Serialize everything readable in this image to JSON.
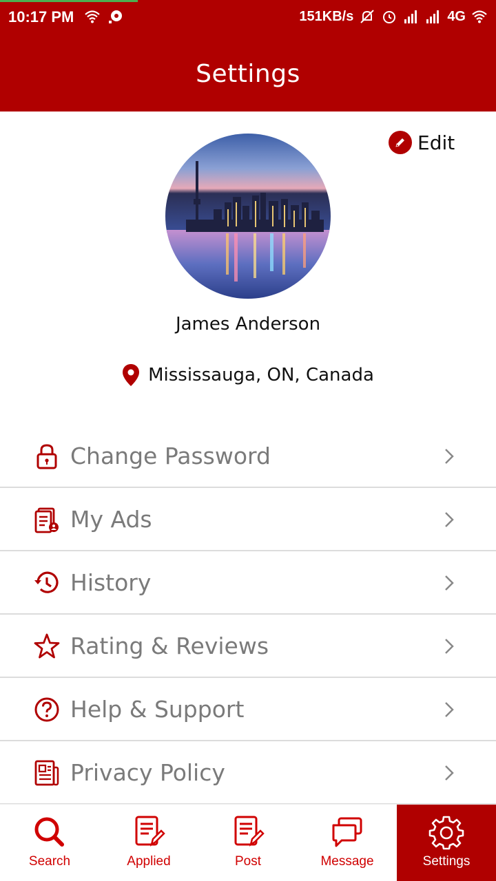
{
  "status_bar": {
    "time": "10:17 PM",
    "speed": "151KB/s",
    "network": "4G"
  },
  "header": {
    "title": "Settings"
  },
  "profile": {
    "edit_label": "Edit",
    "name": "James Anderson",
    "location": "Mississauga, ON, Canada"
  },
  "menu": {
    "items": [
      {
        "label": "Change Password",
        "icon": "lock-icon"
      },
      {
        "label": "My Ads",
        "icon": "ads-document-icon"
      },
      {
        "label": "History",
        "icon": "history-icon"
      },
      {
        "label": "Rating & Reviews",
        "icon": "star-icon"
      },
      {
        "label": "Help & Support",
        "icon": "help-icon"
      },
      {
        "label": "Privacy Policy",
        "icon": "policy-document-icon"
      }
    ]
  },
  "bottom_nav": {
    "items": [
      {
        "label": "Search",
        "icon": "search-icon"
      },
      {
        "label": "Applied",
        "icon": "applied-icon"
      },
      {
        "label": "Post",
        "icon": "post-icon"
      },
      {
        "label": "Message",
        "icon": "message-icon"
      },
      {
        "label": "Settings",
        "icon": "gear-icon",
        "active": true
      }
    ]
  },
  "colors": {
    "brand": "#b00000",
    "menu_text": "#7a7a7a",
    "divider": "#dcdcdc"
  }
}
